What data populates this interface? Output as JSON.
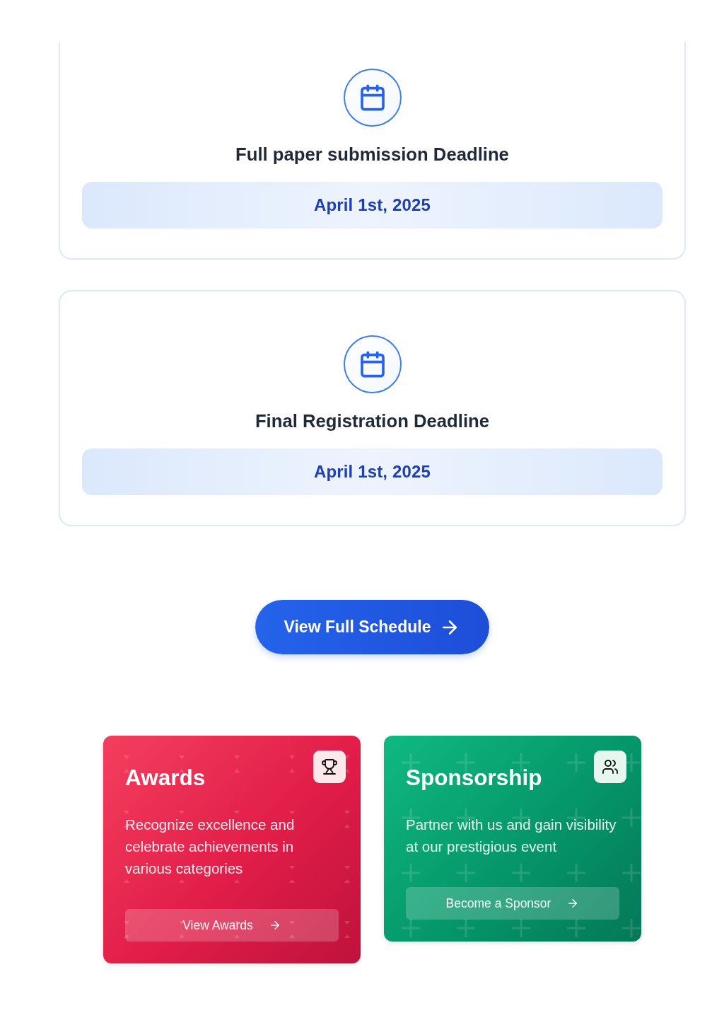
{
  "deadlines": [
    {
      "title": "Full paper submission Deadline",
      "date": "April 1st, 2025"
    },
    {
      "title": "Final Registration Deadline",
      "date": "April 1st, 2025"
    }
  ],
  "schedule_button": {
    "label": "View Full Schedule"
  },
  "feature_cards": [
    {
      "kind": "awards",
      "title": "Awards",
      "description": "Recognize excellence and celebrate achievements in various categories",
      "button": "View Awards"
    },
    {
      "kind": "sponsorship",
      "title": "Sponsorship",
      "description": "Partner with us and gain visibility at our prestigious event",
      "button": "Become a Sponsor"
    }
  ]
}
